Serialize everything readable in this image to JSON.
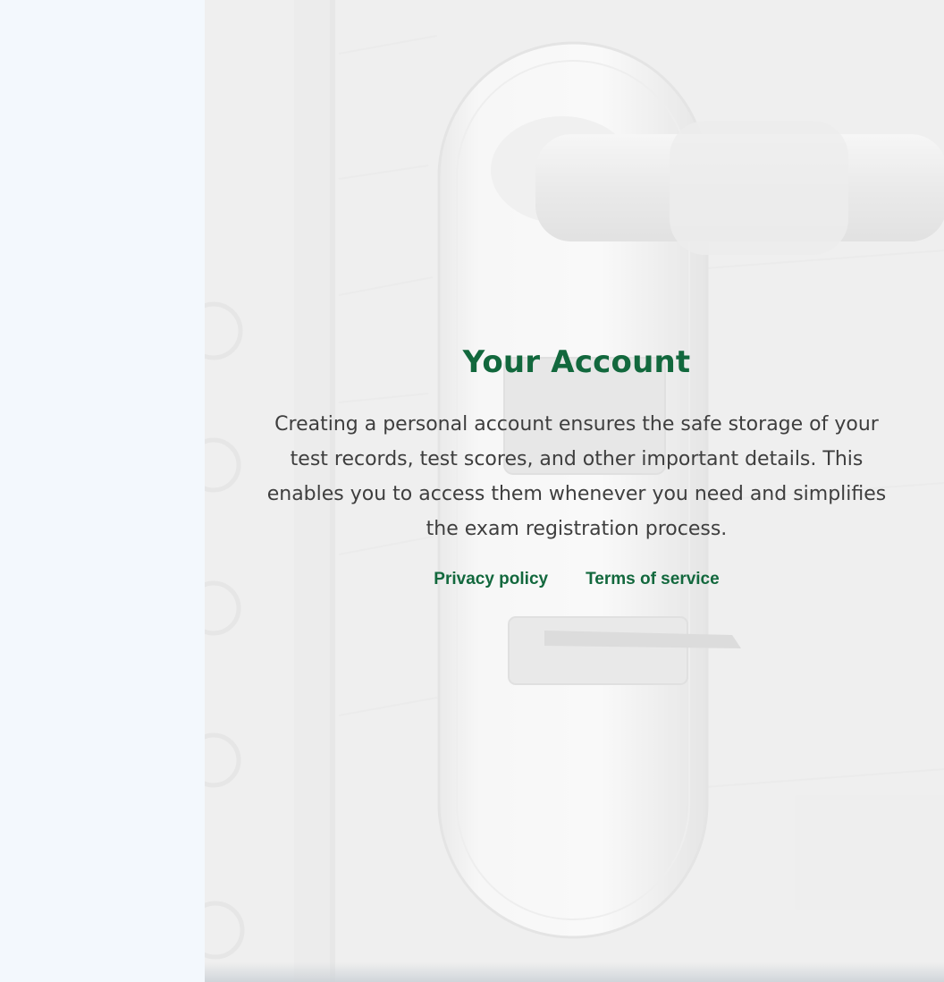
{
  "hero": {
    "title": "Your Account",
    "description": "Creating a personal account ensures the safe storage of your test records, test scores, and other important details. This enables you to access them whenever you need and simplifies the exam registration process.",
    "background_image": "door-lock-handle-image"
  },
  "links": {
    "privacy": "Privacy policy",
    "terms": "Terms of service"
  },
  "colors": {
    "accent": "#12683d",
    "text": "#3e3e3e",
    "rail_background": "#f3f8fd"
  }
}
